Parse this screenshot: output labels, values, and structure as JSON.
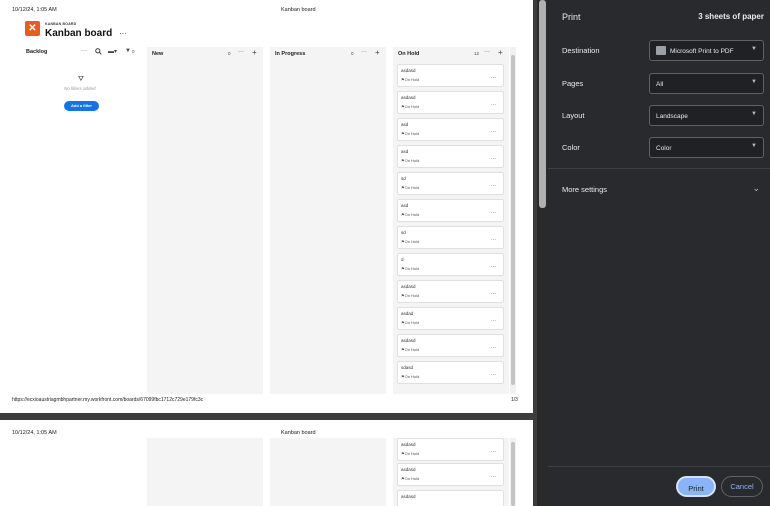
{
  "preview": {
    "header_date": "10/12/24, 1:05 AM",
    "header_title": "Kanban board",
    "footer_url": "https://ecxioaustriagmbhpartner.my.workfront.com/boards/67099fbc1712c729e179fc3c",
    "footer_page": "1/3",
    "app": {
      "kicker": "KANBAN BOARD",
      "title": "Kanban board",
      "more": "···"
    },
    "backlog": {
      "label": "Backlog",
      "filter_count": "0",
      "no_filters": "No filters added",
      "add_filter": "Add a filter"
    },
    "columns": [
      {
        "label": "New",
        "count": "0"
      },
      {
        "label": "In Progress",
        "count": "0"
      },
      {
        "label": "On Hold",
        "count": "12"
      }
    ],
    "cards": [
      {
        "title": "asdasd",
        "status": "On Hold"
      },
      {
        "title": "asdasd",
        "status": "On Hold"
      },
      {
        "title": "asd",
        "status": "On Hold"
      },
      {
        "title": "asd",
        "status": "On Hold"
      },
      {
        "title": "sd",
        "status": "On Hold"
      },
      {
        "title": "asd",
        "status": "On Hold"
      },
      {
        "title": "sd",
        "status": "On Hold"
      },
      {
        "title": "d",
        "status": "On Hold"
      },
      {
        "title": "asdasd",
        "status": "On Hold"
      },
      {
        "title": "asdad",
        "status": "On Hold"
      },
      {
        "title": "asdasd",
        "status": "On Hold"
      },
      {
        "title": "sdasd",
        "status": "On Hold"
      }
    ],
    "page2_cards": [
      {
        "title": "asdasd",
        "status": "On Hold"
      },
      {
        "title": "asdasd",
        "status": "On Hold"
      },
      {
        "title": "asdasd",
        "status": ""
      }
    ]
  },
  "print": {
    "title": "Print",
    "sheets": "3 sheets of paper",
    "destination_label": "Destination",
    "destination_value": "Microsoft Print to PDF",
    "pages_label": "Pages",
    "pages_value": "All",
    "layout_label": "Layout",
    "layout_value": "Landscape",
    "color_label": "Color",
    "color_value": "Color",
    "more_settings": "More settings",
    "print_button": "Print",
    "cancel_button": "Cancel"
  },
  "colors": {
    "accent": "#8ab4f8",
    "brand": "#e55d1f",
    "filter_button": "#1473e6",
    "panel_bg": "#292a2d"
  },
  "icons": [
    "workfront-logo-icon",
    "search-icon",
    "filter-icon",
    "printer-icon",
    "chevron-down-icon",
    "flag-icon",
    "more-icon",
    "plus-icon"
  ]
}
